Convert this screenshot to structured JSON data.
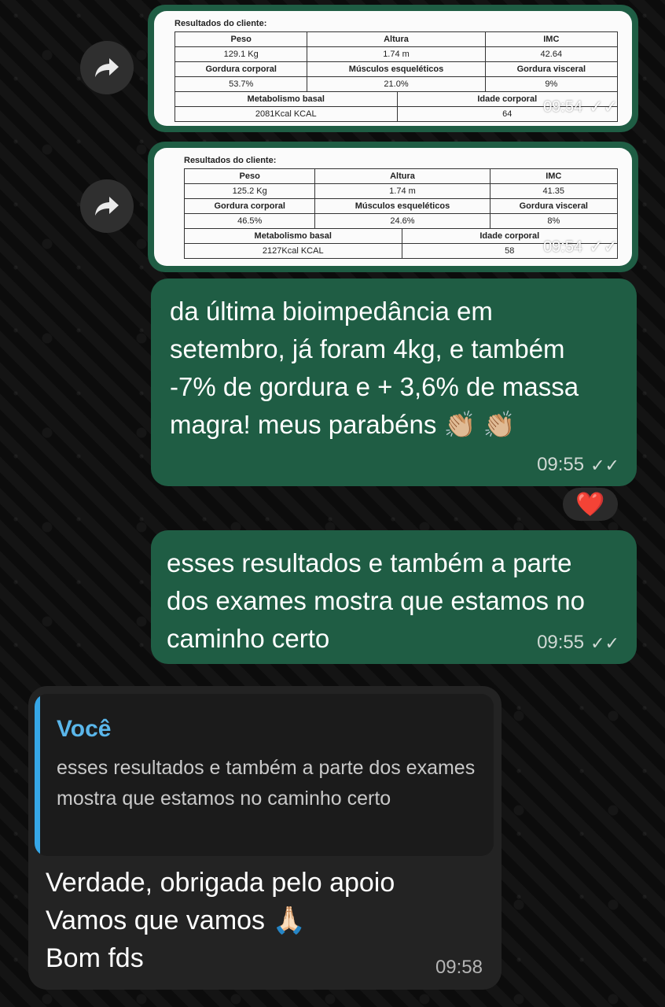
{
  "messages": {
    "forwarded_images": [
      {
        "table_title": "Resultados do cliente:",
        "headers": [
          "Peso",
          "Altura",
          "IMC"
        ],
        "values": [
          "129.1 Kg",
          "1.74 m",
          "42.64"
        ],
        "headers2": [
          "Gordura corporal",
          "Músculos esqueléticos",
          "Gordura visceral"
        ],
        "values2": [
          "53.7%",
          "21.0%",
          "9%"
        ],
        "headers3": [
          "Metabolismo basal",
          "Idade corporal"
        ],
        "values3": [
          "2081Kcal KCAL",
          "64"
        ],
        "time": "09:54",
        "status_icon": "double-check-icon"
      },
      {
        "table_title": "Resultados do cliente:",
        "headers": [
          "Peso",
          "Altura",
          "IMC"
        ],
        "values": [
          "125.2 Kg",
          "1.74 m",
          "41.35"
        ],
        "headers2": [
          "Gordura corporal",
          "Músculos esqueléticos",
          "Gordura visceral"
        ],
        "values2": [
          "46.5%",
          "24.6%",
          "8%"
        ],
        "headers3": [
          "Metabolismo basal",
          "Idade corporal"
        ],
        "values3": [
          "2127Kcal KCAL",
          "58"
        ],
        "time": "09:54",
        "status_icon": "double-check-icon"
      }
    ],
    "outgoing": [
      {
        "text": "da última bioimpedância em setembro, já foram 4kg, e também -7% de gordura e + 3,6% de massa magra! meus parabéns 👏🏼 👏🏼",
        "time": "09:55",
        "status_icon": "double-check-icon"
      },
      {
        "text": "esses resultados e também a parte dos exames mostra que estamos no caminho certo",
        "time": "09:55",
        "status_icon": "double-check-icon"
      }
    ],
    "reaction": {
      "emoji": "❤️"
    },
    "incoming": {
      "quote_author": "Você",
      "quote_text": "esses resultados e também a parte dos exames mostra que estamos no caminho certo",
      "text": "Verdade, obrigada pelo apoio\nVamos que vamos 🙏🏻\nBom fds",
      "time": "09:58"
    }
  },
  "icons": {
    "forward": "forward-arrow-icon"
  },
  "colors": {
    "outgoing_bubble": "#1f5d44",
    "incoming_bubble": "#232323",
    "quote_accent": "#36a7e8"
  }
}
